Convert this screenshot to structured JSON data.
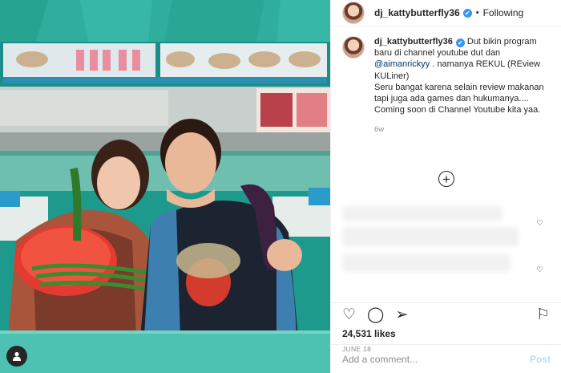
{
  "post_header": {
    "username": "dj_kattybutterfly36",
    "verified_mark": "✔",
    "separator": "•",
    "follow_status": "Following"
  },
  "caption": {
    "username": "dj_kattybutterfly36",
    "verified_mark": "✔",
    "text_part1": " Dut bikin program baru di channel youtube dut dan ",
    "mention": "@aimanrickyy",
    "text_part2": " . namanya REKUL (REview KULiner)",
    "text_part3": "Seru bangat karena selain review makanan tapi juga ada games dan hukumanya.... Coming soon di Channel Youtube kita yaa.",
    "age": "6w"
  },
  "more_comments_icon": "+",
  "comment_like_icon": "♡",
  "actions": {
    "like_icon": "♡",
    "comment_icon": "◯",
    "share_icon": "➢",
    "save_icon": "⚐"
  },
  "likes": "24,531 likes",
  "date": "JUNE 18",
  "add_comment": {
    "placeholder": "Add a comment...",
    "post_label": "Post"
  },
  "colors": {
    "verified": "#3897f0",
    "post_button": "#b2dffc",
    "mention": "#00376b"
  }
}
